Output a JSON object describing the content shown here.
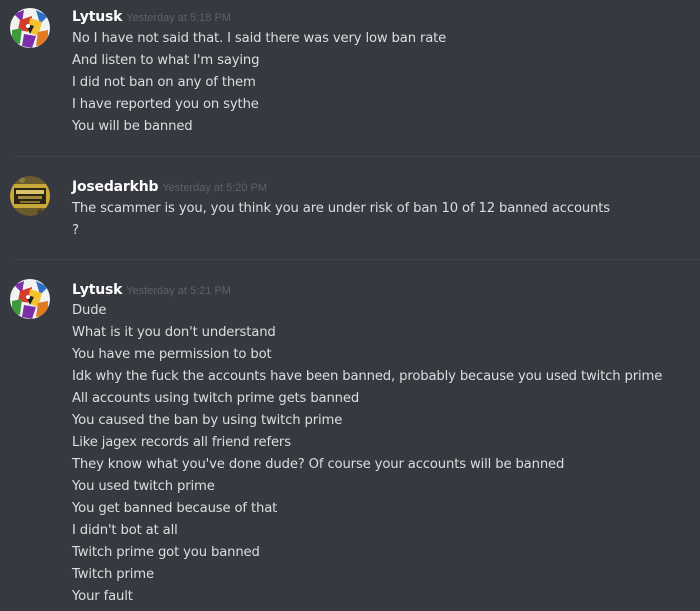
{
  "messages": [
    {
      "username": "Lytusk",
      "timestamp": "Yesterday at 5:18 PM",
      "avatar_icon": "lytusk-avatar-icon",
      "lines": [
        "No I have not said that. I said there was very low ban rate",
        "And listen to what I'm saying",
        "I did not ban on any of them",
        "I have reported you on sythe",
        "You will be banned"
      ]
    },
    {
      "username": "Josedarkhb",
      "timestamp": "Yesterday at 5:20 PM",
      "avatar_icon": "josedarkhb-avatar-icon",
      "lines": [
        "The scammer is you, you think you are under risk of ban 10 of 12 banned accounts",
        "?"
      ]
    },
    {
      "username": "Lytusk",
      "timestamp": "Yesterday at 5:21 PM",
      "avatar_icon": "lytusk-avatar-icon",
      "lines": [
        "Dude",
        "What is it you don't understand",
        "You have me permission to bot",
        "Idk why the fuck the accounts have been banned, probably because you used twitch prime",
        "All accounts using twitch prime gets banned",
        "You caused the ban by using twitch prime",
        "Like jagex records all friend refers",
        "They know what you've done dude? Of course your accounts will be banned",
        "You used twitch prime",
        "You get banned because of that",
        "I didn't bot at all",
        "Twitch prime got you banned",
        "Twitch prime",
        "Your fault"
      ]
    }
  ],
  "colors": {
    "background": "#36393f",
    "username": "#ffffff",
    "timestamp": "#5e6167",
    "message_text": "#dcddde",
    "divider": "#3f4248"
  }
}
